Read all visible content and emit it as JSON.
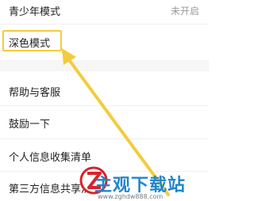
{
  "settings": {
    "teen_mode": {
      "label": "青少年模式",
      "value": "未开启"
    },
    "dark_mode": {
      "label": "深色模式"
    },
    "help": {
      "label": "帮助与客服"
    },
    "rate": {
      "label": "鼓励一下"
    },
    "personal_info": {
      "label": "个人信息收集清单"
    },
    "third_party": {
      "label": "第三方信息共享清单"
    }
  },
  "watermark": {
    "title": "主观下载站",
    "url": "www.zghdw888.com"
  },
  "colors": {
    "highlight": "#f2cc3c",
    "watermark_blue": "#1f86c9",
    "watermark_red": "#d8232a"
  }
}
